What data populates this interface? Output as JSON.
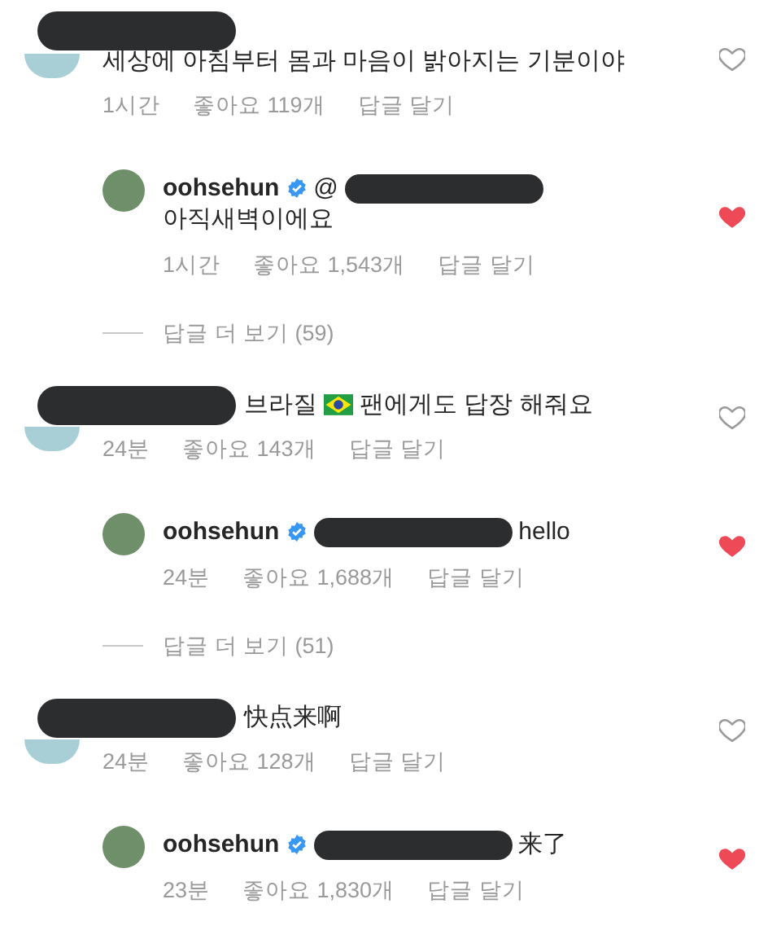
{
  "items": [
    {
      "kind": "comment",
      "redacted": true,
      "segments": [
        {
          "kind": "text",
          "text": "세상에 아침부터 몸과 마음이 밝아지는 기분이야"
        }
      ],
      "time": "1시간",
      "likes": "좋아요 119개",
      "reply": "답글 달기",
      "liked": false
    },
    {
      "kind": "reply",
      "username": "oohsehun",
      "verified": true,
      "prefix": "@",
      "redacted": true,
      "segments": [
        {
          "kind": "text",
          "text": "아직새벽이에요"
        }
      ],
      "time": "1시간",
      "likes": "좋아요 1,543개",
      "reply": "답글 달기",
      "liked": true
    },
    {
      "kind": "more",
      "text": "답글 더 보기 (59)"
    },
    {
      "kind": "comment",
      "redacted": true,
      "segments": [
        {
          "kind": "text",
          "text": "브라질"
        },
        {
          "kind": "flag"
        },
        {
          "kind": "text",
          "text": "팬에게도 답장 해줘요"
        }
      ],
      "time": "24분",
      "likes": "좋아요 143개",
      "reply": "답글 달기",
      "liked": false
    },
    {
      "kind": "reply",
      "username": "oohsehun",
      "verified": true,
      "redacted": true,
      "segments": [
        {
          "kind": "text",
          "text": "hello"
        }
      ],
      "time": "24분",
      "likes": "좋아요 1,688개",
      "reply": "답글 달기",
      "liked": true
    },
    {
      "kind": "more",
      "text": "답글 더 보기 (51)"
    },
    {
      "kind": "comment",
      "redacted": true,
      "segments": [
        {
          "kind": "text",
          "text": "快点来啊"
        }
      ],
      "time": "24분",
      "likes": "좋아요 128개",
      "reply": "답글 달기",
      "liked": false
    },
    {
      "kind": "reply",
      "username": "oohsehun",
      "verified": true,
      "redacted": true,
      "segments": [
        {
          "kind": "text",
          "text": "来了"
        }
      ],
      "time": "23분",
      "likes": "좋아요 1,830개",
      "reply": "답글 달기",
      "liked": true
    }
  ]
}
